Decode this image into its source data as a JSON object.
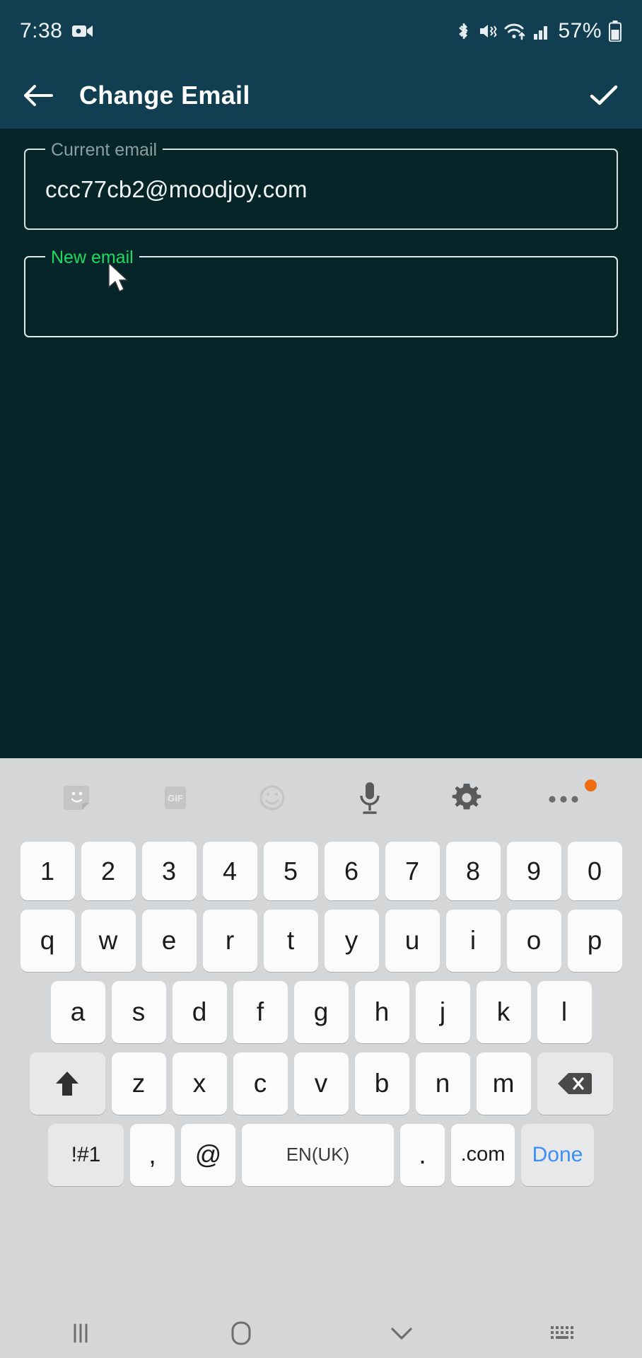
{
  "status_bar": {
    "time": "7:38",
    "battery_percent": "57%",
    "icons": [
      "video-camera-icon",
      "bluetooth-icon",
      "vibrate-mute-icon",
      "wifi-icon",
      "cellular-signal-icon",
      "battery-icon"
    ],
    "background_color": "#123e51",
    "text_color": "#eef3f5"
  },
  "app_bar": {
    "title": "Change Email",
    "back_label": "Back",
    "confirm_label": "Confirm",
    "background_color": "#123e51"
  },
  "form": {
    "current_email": {
      "label": "Current email",
      "value": "ccc77cb2@moodjoy.com",
      "placeholder": "",
      "label_color": "#8d9ea2"
    },
    "new_email": {
      "label": "New email",
      "value": "",
      "placeholder": "",
      "label_color": "#1ddb62"
    }
  },
  "keyboard": {
    "background_color": "#d5d6d8",
    "key_color": "#fbfbfb",
    "toolbar": [
      {
        "name": "sticker-icon",
        "label": ""
      },
      {
        "name": "gif-icon",
        "label": "GIF"
      },
      {
        "name": "emoji-icon",
        "label": ""
      },
      {
        "name": "microphone-icon",
        "label": ""
      },
      {
        "name": "gear-icon",
        "label": ""
      },
      {
        "name": "overflow-menu-icon",
        "label": ""
      }
    ],
    "badge_color": "#ef6c11",
    "rows": {
      "numbers": [
        "1",
        "2",
        "3",
        "4",
        "5",
        "6",
        "7",
        "8",
        "9",
        "0"
      ],
      "top": [
        "q",
        "w",
        "e",
        "r",
        "t",
        "y",
        "u",
        "i",
        "o",
        "p"
      ],
      "home": [
        "a",
        "s",
        "d",
        "f",
        "g",
        "h",
        "j",
        "k",
        "l"
      ],
      "bottom": [
        "z",
        "x",
        "c",
        "v",
        "b",
        "n",
        "m"
      ]
    },
    "shift_label": "",
    "backspace_label": "",
    "symbols_label": "!#1",
    "comma_label": ",",
    "at_label": "@",
    "space_label": "EN(UK)",
    "period_label": ".",
    "dotcom_label": ".com",
    "done_label": "Done",
    "done_color": "#3d8ef7"
  },
  "nav_bar": {
    "recents_label": "Recents",
    "home_label": "Home",
    "hide_keyboard_label": "Hide keyboard",
    "switch_keyboard_label": "Switch keyboard",
    "background_color": "#d5d6d8"
  }
}
